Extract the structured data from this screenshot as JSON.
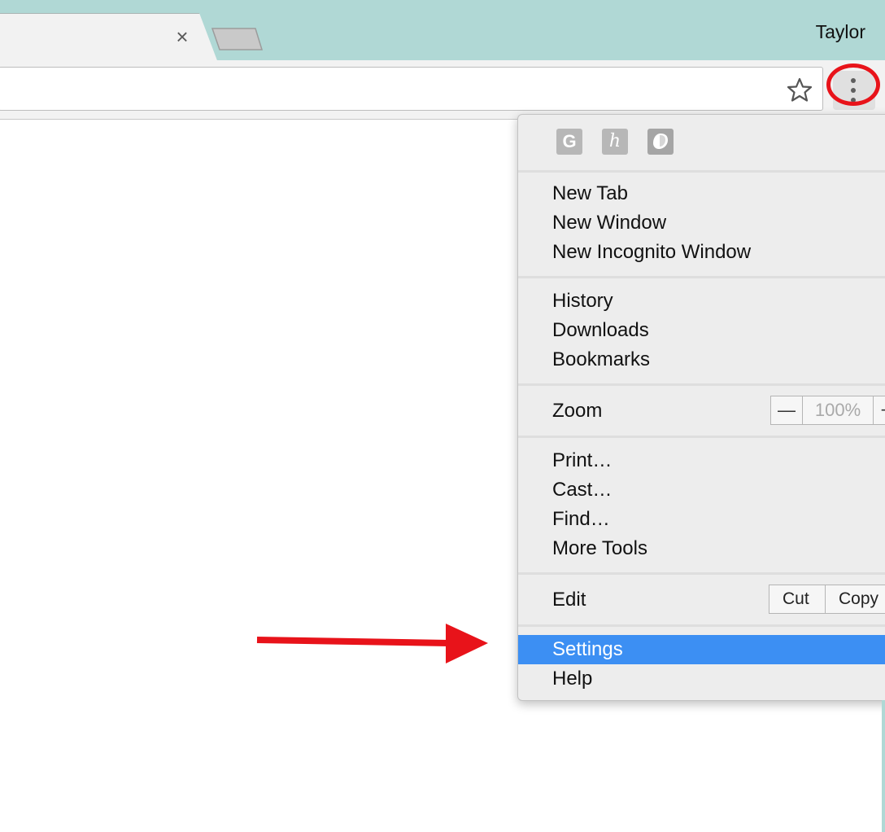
{
  "browser": {
    "tab_close_icon": "×",
    "profile_name": "Taylor"
  },
  "menu": {
    "extensions": [
      {
        "label": "G",
        "icon": "grammarly-extension-icon"
      },
      {
        "label": "h",
        "icon": "honey-extension-icon"
      },
      {
        "label": "",
        "icon": "shield-extension-icon"
      }
    ],
    "group1": [
      "New Tab",
      "New Window",
      "New Incognito Window"
    ],
    "group2": [
      "History",
      "Downloads",
      "Bookmarks"
    ],
    "zoom": {
      "label": "Zoom",
      "minus": "—",
      "value": "100%",
      "plus": "+"
    },
    "group3": [
      "Print…",
      "Cast…",
      "Find…",
      "More Tools"
    ],
    "edit": {
      "label": "Edit",
      "cut": "Cut",
      "copy": "Copy"
    },
    "group4": {
      "settings": "Settings",
      "help": "Help"
    }
  },
  "colors": {
    "titlebar": "#b0d8d5",
    "selected_item": "#3c8ff3",
    "annotation": "#e8131a"
  }
}
